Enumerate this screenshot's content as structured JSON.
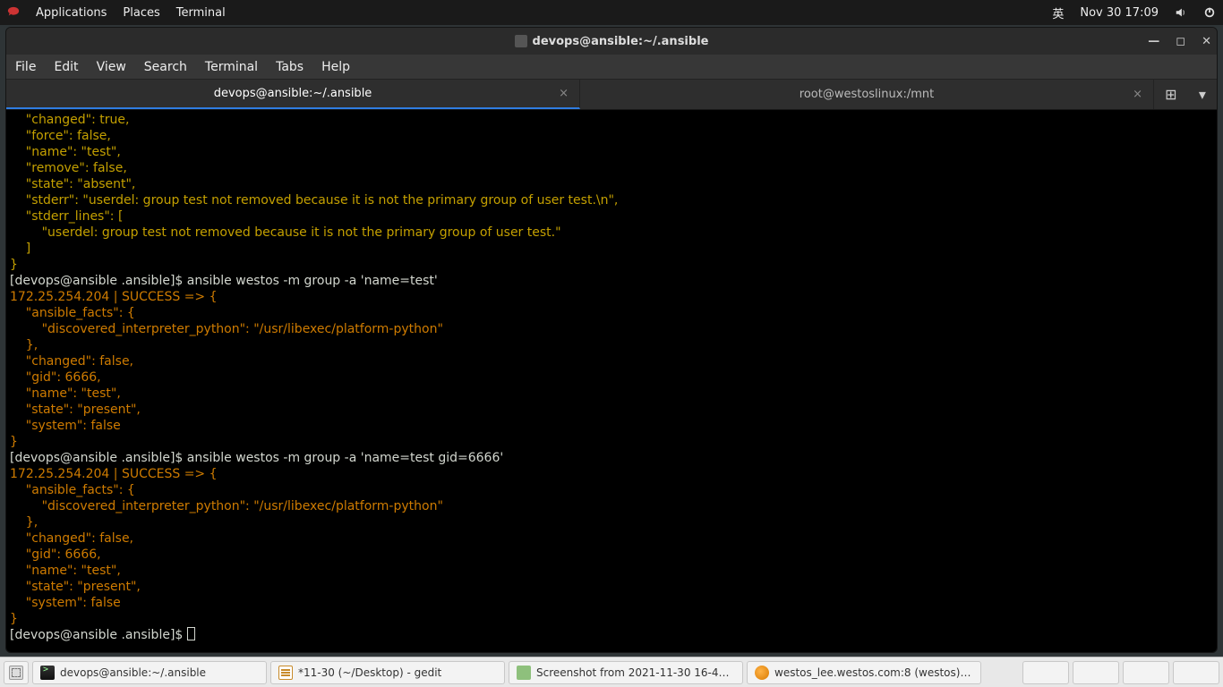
{
  "topbar": {
    "menus": [
      "Applications",
      "Places",
      "Terminal"
    ],
    "ime": "英",
    "datetime": "Nov 30  17:09"
  },
  "window": {
    "title": "devops@ansible:~/.ansible",
    "menus": [
      "File",
      "Edit",
      "View",
      "Search",
      "Terminal",
      "Tabs",
      "Help"
    ]
  },
  "tabs": [
    {
      "label": "devops@ansible:~/.ansible",
      "active": true
    },
    {
      "label": "root@westoslinux:/mnt",
      "active": false
    }
  ],
  "terminal": {
    "lines": [
      {
        "cls": "y",
        "text": "    \"changed\": true,"
      },
      {
        "cls": "y",
        "text": "    \"force\": false,"
      },
      {
        "cls": "y",
        "text": "    \"name\": \"test\","
      },
      {
        "cls": "y",
        "text": "    \"remove\": false,"
      },
      {
        "cls": "y",
        "text": "    \"state\": \"absent\","
      },
      {
        "cls": "y",
        "text": "    \"stderr\": \"userdel: group test not removed because it is not the primary group of user test.\\n\","
      },
      {
        "cls": "y",
        "text": "    \"stderr_lines\": ["
      },
      {
        "cls": "y",
        "text": "        \"userdel: group test not removed because it is not the primary group of user test.\""
      },
      {
        "cls": "y",
        "text": "    ]"
      },
      {
        "cls": "y",
        "text": "}"
      },
      {
        "cls": "prompt1",
        "prompt": "[devops@ansible .ansible]$ ",
        "cmd": "ansible westos -m group -a 'name=test'"
      },
      {
        "cls": "o",
        "text": "172.25.254.204 | SUCCESS => {"
      },
      {
        "cls": "o",
        "text": "    \"ansible_facts\": {"
      },
      {
        "cls": "o",
        "text": "        \"discovered_interpreter_python\": \"/usr/libexec/platform-python\""
      },
      {
        "cls": "o",
        "text": "    },"
      },
      {
        "cls": "o",
        "text": "    \"changed\": false,"
      },
      {
        "cls": "o",
        "text": "    \"gid\": 6666,"
      },
      {
        "cls": "o",
        "text": "    \"name\": \"test\","
      },
      {
        "cls": "o",
        "text": "    \"state\": \"present\","
      },
      {
        "cls": "o",
        "text": "    \"system\": false"
      },
      {
        "cls": "o",
        "text": "}"
      },
      {
        "cls": "prompt1",
        "prompt": "[devops@ansible .ansible]$ ",
        "cmd": "ansible westos -m group -a 'name=test gid=6666'"
      },
      {
        "cls": "o",
        "text": "172.25.254.204 | SUCCESS => {"
      },
      {
        "cls": "o",
        "text": "    \"ansible_facts\": {"
      },
      {
        "cls": "o",
        "text": "        \"discovered_interpreter_python\": \"/usr/libexec/platform-python\""
      },
      {
        "cls": "o",
        "text": "    },"
      },
      {
        "cls": "o",
        "text": "    \"changed\": false,"
      },
      {
        "cls": "o",
        "text": "    \"gid\": 6666,"
      },
      {
        "cls": "o",
        "text": "    \"name\": \"test\","
      },
      {
        "cls": "o",
        "text": "    \"state\": \"present\","
      },
      {
        "cls": "o",
        "text": "    \"system\": false"
      },
      {
        "cls": "o",
        "text": "}"
      },
      {
        "cls": "prompt-cursor",
        "prompt": "[devops@ansible .ansible]$ "
      }
    ]
  },
  "taskbar": {
    "items": [
      {
        "icon": "ic-terminal",
        "label": "devops@ansible:~/.ansible"
      },
      {
        "icon": "ic-gedit",
        "label": "*11-30 (~/Desktop) - gedit"
      },
      {
        "icon": "ic-img",
        "label": "Screenshot from 2021-11-30 16-4…"
      },
      {
        "icon": "ic-vm",
        "label": "westos_lee.westos.com:8 (westos) …"
      }
    ]
  }
}
